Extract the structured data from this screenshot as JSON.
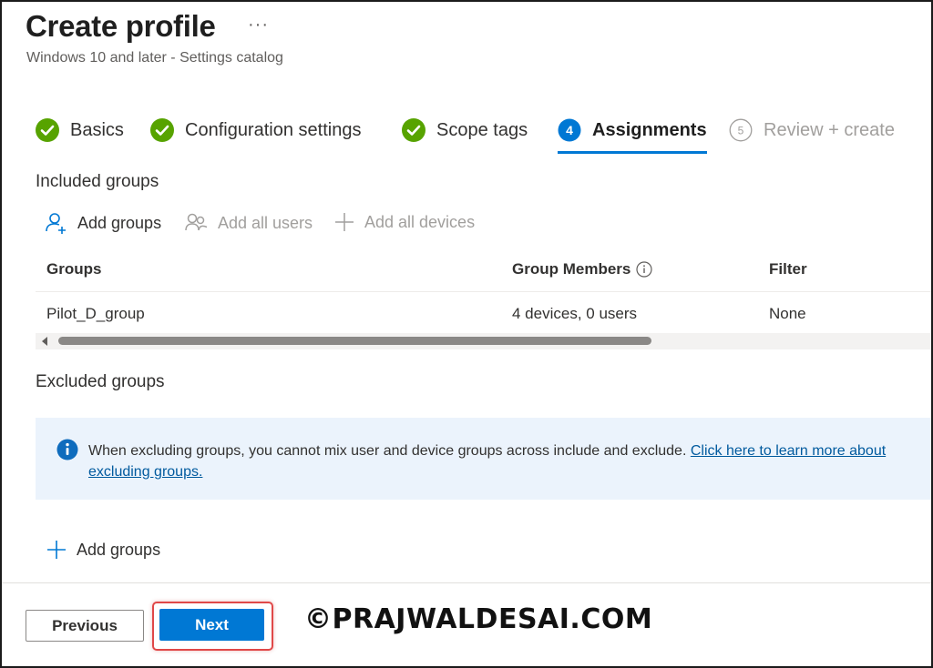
{
  "header": {
    "title": "Create profile",
    "more_icon": "ellipsis-icon",
    "more_label": "···",
    "subtitle": "Windows 10 and later - Settings catalog"
  },
  "wizard": {
    "steps": [
      {
        "label": "Basics",
        "state": "completed",
        "icon": "check-circle-icon"
      },
      {
        "label": "Configuration settings",
        "state": "completed",
        "icon": "check-circle-icon"
      },
      {
        "label": "Scope tags",
        "state": "completed",
        "icon": "check-circle-icon"
      },
      {
        "label": "Assignments",
        "state": "current",
        "number": "4"
      },
      {
        "label": "Review + create",
        "state": "future",
        "number": "5"
      }
    ],
    "colors": {
      "completed": "#57a300",
      "current": "#0078d4",
      "future": "#a19f9d"
    }
  },
  "included": {
    "title": "Included groups",
    "commands": {
      "add_groups": "Add groups",
      "add_all_users": "Add all users",
      "add_all_devices": "Add all devices"
    },
    "table": {
      "columns": [
        "Groups",
        "Group Members",
        "Filter"
      ],
      "rows": [
        {
          "group": "Pilot_D_group",
          "members": "4 devices, 0 users",
          "filter": "None"
        }
      ]
    }
  },
  "excluded": {
    "title": "Excluded groups",
    "info_text": "When excluding groups, you cannot mix user and device groups across include and exclude. ",
    "info_link": "Click here to learn more about excluding groups.",
    "add_groups": "Add groups"
  },
  "footer": {
    "previous_label": "Previous",
    "next_label": "Next"
  },
  "watermark": "©PRAJWALDESAI.COM",
  "colors": {
    "accent": "#0078d4",
    "success": "#57a300",
    "info_background": "#ebf3fc",
    "highlight": "#e04848"
  }
}
